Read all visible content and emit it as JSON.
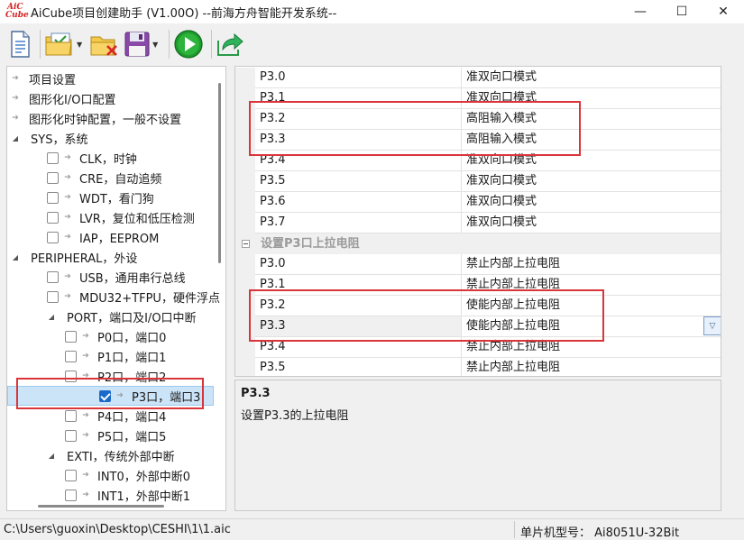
{
  "window": {
    "logo_line1": "AiC",
    "logo_line2": "Cube",
    "title": "AiCube项目创建助手 (V1.00O) --前海方舟智能开发系统--",
    "controls": {
      "minimize": "—",
      "maximize": "☐",
      "close": "✕"
    }
  },
  "toolbar": {
    "buttons": [
      "new-document",
      "open-project",
      "close-project",
      "save",
      "run",
      "export"
    ]
  },
  "tree": {
    "items": [
      {
        "label": "项目设置",
        "level": 0,
        "kind": "arrow"
      },
      {
        "label": "图形化I/O口配置",
        "level": 0,
        "kind": "arrow"
      },
      {
        "label": "图形化时钟配置，一般不设置",
        "level": 0,
        "kind": "arrow"
      },
      {
        "label": "SYS，系统",
        "level": 0,
        "kind": "expanded"
      },
      {
        "label": "CLK，时钟",
        "level": 1,
        "kind": "check",
        "checked": false
      },
      {
        "label": "CRE，自动追频",
        "level": 1,
        "kind": "check",
        "checked": false
      },
      {
        "label": "WDT，看门狗",
        "level": 1,
        "kind": "check",
        "checked": false
      },
      {
        "label": "LVR，复位和低压检测",
        "level": 1,
        "kind": "check",
        "checked": false
      },
      {
        "label": "IAP，EEPROM",
        "level": 1,
        "kind": "check",
        "checked": false
      },
      {
        "label": "PERIPHERAL，外设",
        "level": 0,
        "kind": "expanded"
      },
      {
        "label": "USB，通用串行总线",
        "level": 1,
        "kind": "check",
        "checked": false
      },
      {
        "label": "MDU32+TFPU，硬件浮点",
        "level": 1,
        "kind": "check",
        "checked": false
      },
      {
        "label": "PORT，端口及I/O口中断",
        "level": 1,
        "kind": "expanded"
      },
      {
        "label": "P0口，端口0",
        "level": 2,
        "kind": "check",
        "checked": false
      },
      {
        "label": "P1口，端口1",
        "level": 2,
        "kind": "check",
        "checked": false
      },
      {
        "label": "P2口，端口2",
        "level": 2,
        "kind": "check",
        "checked": false
      },
      {
        "label": "P3口，端口3",
        "level": 2,
        "kind": "check",
        "checked": true,
        "selected": true
      },
      {
        "label": "P4口，端口4",
        "level": 2,
        "kind": "check",
        "checked": false
      },
      {
        "label": "P5口，端口5",
        "level": 2,
        "kind": "check",
        "checked": false
      },
      {
        "label": "EXTI，传统外部中断",
        "level": 1,
        "kind": "expanded"
      },
      {
        "label": "INT0，外部中断0",
        "level": 2,
        "kind": "check",
        "checked": false
      },
      {
        "label": "INT1，外部中断1",
        "level": 2,
        "kind": "check",
        "checked": false
      }
    ]
  },
  "grid": {
    "rows": [
      {
        "type": "prop",
        "name": "P3.0",
        "value": "准双向口模式"
      },
      {
        "type": "prop",
        "name": "P3.1",
        "value": "准双向口模式"
      },
      {
        "type": "prop",
        "name": "P3.2",
        "value": "高阻输入模式"
      },
      {
        "type": "prop",
        "name": "P3.3",
        "value": "高阻输入模式"
      },
      {
        "type": "prop",
        "name": "P3.4",
        "value": "准双向口模式"
      },
      {
        "type": "prop",
        "name": "P3.5",
        "value": "准双向口模式"
      },
      {
        "type": "prop",
        "name": "P3.6",
        "value": "准双向口模式"
      },
      {
        "type": "prop",
        "name": "P3.7",
        "value": "准双向口模式"
      },
      {
        "type": "category",
        "name": "设置P3口上拉电阻"
      },
      {
        "type": "prop",
        "name": "P3.0",
        "value": "禁止内部上拉电阻"
      },
      {
        "type": "prop",
        "name": "P3.1",
        "value": "禁止内部上拉电阻"
      },
      {
        "type": "prop",
        "name": "P3.2",
        "value": "使能内部上拉电阻"
      },
      {
        "type": "prop",
        "name": "P3.3",
        "value": "使能内部上拉电阻",
        "selected": true
      },
      {
        "type": "prop",
        "name": "P3.4",
        "value": "禁止内部上拉电阻"
      },
      {
        "type": "prop",
        "name": "P3.5",
        "value": "禁止内部上拉电阻"
      }
    ]
  },
  "description": {
    "title": "P3.3",
    "text": "设置P3.3的上拉电阻"
  },
  "status": {
    "path": "C:\\Users\\guoxin\\Desktop\\CESHI\\1\\1.aic",
    "chip": "单片机型号：  Ai8051U-32Bit"
  },
  "colors": {
    "highlight_box": "#d9353a",
    "selection": "#cce4f7",
    "check_blue": "#1b6ac9"
  }
}
